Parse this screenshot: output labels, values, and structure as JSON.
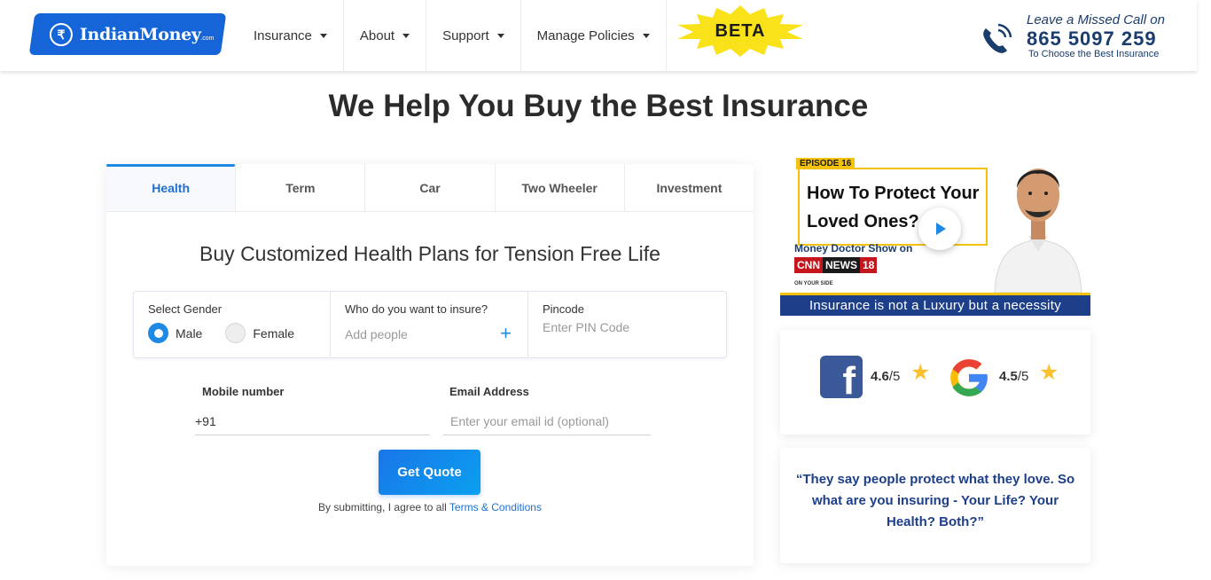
{
  "header": {
    "logo": {
      "text": "IndianMoney",
      "domain": ".com",
      "symbol": "₹"
    },
    "nav": [
      {
        "label": "Insurance"
      },
      {
        "label": "About"
      },
      {
        "label": "Support"
      },
      {
        "label": "Manage Policies"
      }
    ],
    "beta_badge": "BETA",
    "call": {
      "line1": "Leave a Missed Call on",
      "number": "865 5097 259",
      "line3": "To Choose the Best Insurance"
    }
  },
  "hero": {
    "title": "We Help You Buy the Best Insurance"
  },
  "form": {
    "tabs": [
      {
        "label": "Health",
        "active": true
      },
      {
        "label": "Term",
        "active": false
      },
      {
        "label": "Car",
        "active": false
      },
      {
        "label": "Two Wheeler",
        "active": false
      },
      {
        "label": "Investment",
        "active": false
      }
    ],
    "subtitle": "Buy Customized Health Plans for Tension Free Life",
    "gender": {
      "label": "Select Gender",
      "options": [
        {
          "label": "Male",
          "selected": true
        },
        {
          "label": "Female",
          "selected": false
        }
      ]
    },
    "insure": {
      "label": "Who do you want to insure?",
      "placeholder": "Add people"
    },
    "pincode": {
      "label": "Pincode",
      "placeholder": "Enter PIN Code",
      "value": ""
    },
    "mobile": {
      "label": "Mobile number",
      "prefix": "+91",
      "value": ""
    },
    "email": {
      "label": "Email Address",
      "placeholder": "Enter your email id (optional)",
      "value": ""
    },
    "submit_label": "Get Quote",
    "terms_prefix": "By submitting, I agree to all",
    "terms_link": "Terms & Conditions"
  },
  "promo": {
    "episode": "EPISODE 16",
    "title": "How To Protect Your Loved Ones?",
    "show": "Money Doctor Show on",
    "channel_a": "CNN",
    "channel_b": "NEWS",
    "channel_c": "18",
    "channel_tag": "ON YOUR SIDE",
    "banner": "Insurance is not a Luxury but a necessity"
  },
  "ratings": {
    "facebook": {
      "score": "4.6",
      "out_of": "/5"
    },
    "google": {
      "score": "4.5",
      "out_of": "/5"
    }
  },
  "quote": {
    "text": "“They say people protect what they love. So what are you insuring - Your Life? Your Health? Both?”"
  },
  "colors": {
    "brand_blue": "#1565d8",
    "accent_blue": "#1e88e5",
    "navy": "#1d3f8a",
    "star_yellow": "#fbc02d",
    "beta_yellow": "#f9e21a"
  }
}
